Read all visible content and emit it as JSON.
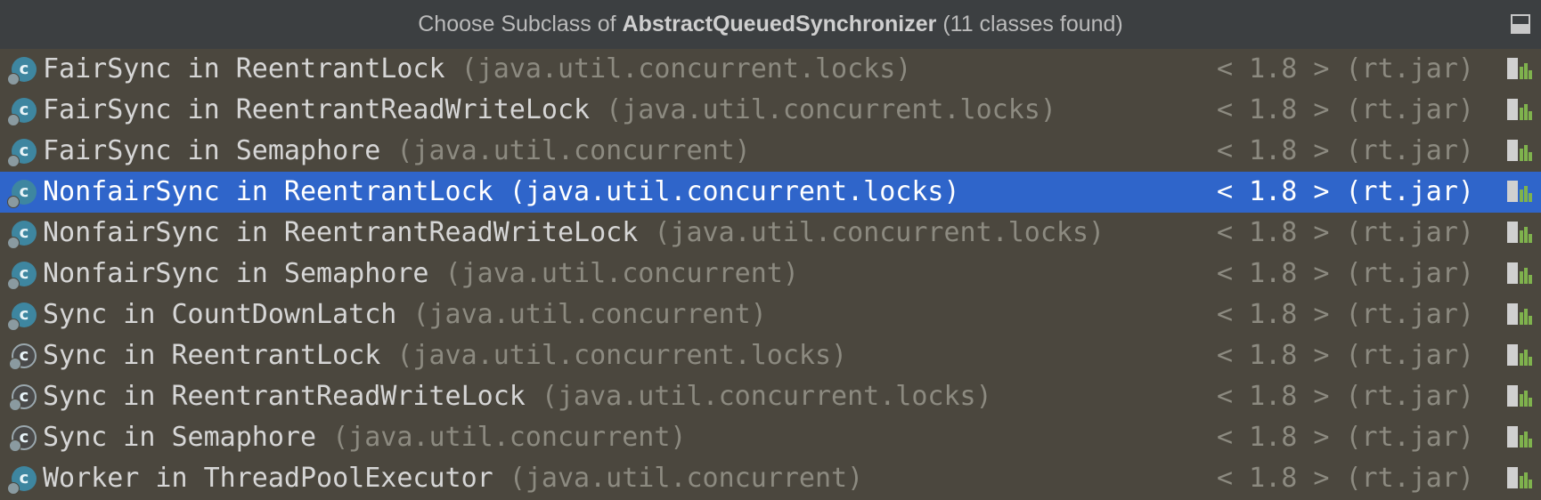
{
  "dialog": {
    "title_prefix": "Choose Subclass of ",
    "title_class": "AbstractQueuedSynchronizer",
    "title_suffix": " (11 classes found)",
    "pin_icon": "pin-window-icon"
  },
  "rows": [
    {
      "name": "FairSync in ReentrantLock",
      "pkg": "(java.util.concurrent.locks)",
      "ver": "< 1.8 > (rt.jar)",
      "icon": "inner-class-icon",
      "selected": false
    },
    {
      "name": "FairSync in ReentrantReadWriteLock",
      "pkg": "(java.util.concurrent.locks)",
      "ver": "< 1.8 > (rt.jar)",
      "icon": "inner-class-icon",
      "selected": false
    },
    {
      "name": "FairSync in Semaphore",
      "pkg": "(java.util.concurrent)",
      "ver": "< 1.8 > (rt.jar)",
      "icon": "inner-class-icon",
      "selected": false
    },
    {
      "name": "NonfairSync in ReentrantLock",
      "pkg": "(java.util.concurrent.locks)",
      "ver": "< 1.8 > (rt.jar)",
      "icon": "inner-class-icon",
      "selected": true
    },
    {
      "name": "NonfairSync in ReentrantReadWriteLock",
      "pkg": "(java.util.concurrent.locks)",
      "ver": "< 1.8 > (rt.jar)",
      "icon": "inner-class-icon",
      "selected": false
    },
    {
      "name": "NonfairSync in Semaphore",
      "pkg": "(java.util.concurrent)",
      "ver": "< 1.8 > (rt.jar)",
      "icon": "inner-class-icon",
      "selected": false
    },
    {
      "name": "Sync in CountDownLatch",
      "pkg": "(java.util.concurrent)",
      "ver": "< 1.8 > (rt.jar)",
      "icon": "inner-class-icon",
      "selected": false
    },
    {
      "name": "Sync in ReentrantLock",
      "pkg": "(java.util.concurrent.locks)",
      "ver": "< 1.8 > (rt.jar)",
      "icon": "abstract-inner-class-icon",
      "selected": false
    },
    {
      "name": "Sync in ReentrantReadWriteLock",
      "pkg": "(java.util.concurrent.locks)",
      "ver": "< 1.8 > (rt.jar)",
      "icon": "abstract-inner-class-icon",
      "selected": false
    },
    {
      "name": "Sync in Semaphore",
      "pkg": "(java.util.concurrent)",
      "ver": "< 1.8 > (rt.jar)",
      "icon": "abstract-inner-class-icon",
      "selected": false
    },
    {
      "name": "Worker in ThreadPoolExecutor",
      "pkg": "(java.util.concurrent)",
      "ver": "< 1.8 > (rt.jar)",
      "icon": "inner-class-icon",
      "selected": false
    }
  ],
  "icon_letter": "c",
  "library_icon": "library-jar-icon",
  "colors": {
    "background": "#4b473e",
    "title_bar": "#3c3f41",
    "selection": "#2f65ca",
    "class_icon": "#3e86a0",
    "dim_text": "#8c8a80"
  }
}
